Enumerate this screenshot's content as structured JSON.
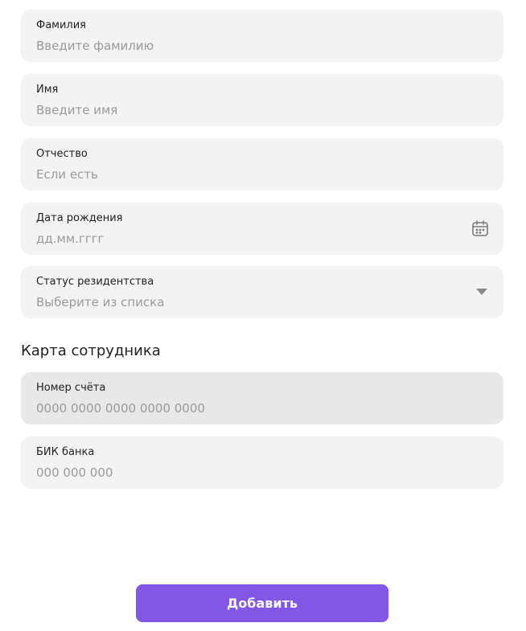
{
  "form": {
    "last_name": {
      "label": "Фамилия",
      "placeholder": "Введите фамилию",
      "value": ""
    },
    "first_name": {
      "label": "Имя",
      "placeholder": "Введите имя",
      "value": ""
    },
    "patronymic": {
      "label": "Отчество",
      "placeholder": "Если есть",
      "value": ""
    },
    "birth_date": {
      "label": "Дата рождения",
      "placeholder": "дд.мм.гггг",
      "value": "",
      "icon": "calendar-icon"
    },
    "residency_status": {
      "label": "Статус резидентства",
      "placeholder": "Выберите из списка",
      "selected": "",
      "icon": "chevron-down-icon"
    }
  },
  "employee_card": {
    "title": "Карта сотрудника",
    "account_number": {
      "label": "Номер счёта",
      "placeholder": "0000 0000 0000 0000 0000",
      "value": "",
      "disabled": true
    },
    "bank_bik": {
      "label": "БИК банка",
      "placeholder": "000 000 000",
      "value": ""
    }
  },
  "actions": {
    "add_label": "Добавить"
  },
  "colors": {
    "accent": "#8257e5",
    "field_bg": "#f3f3f3",
    "field_disabled_bg": "#e8e8e8",
    "placeholder": "#9a9a9a",
    "text": "#1f1f1f"
  }
}
